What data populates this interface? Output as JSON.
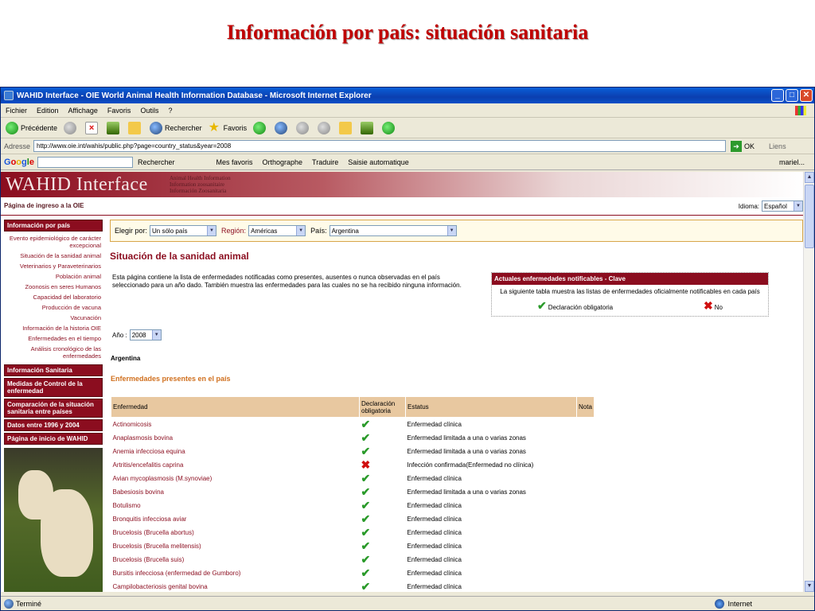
{
  "slide_title": "Información por país: situación sanitaria",
  "window": {
    "title": "WAHID Interface - OIE World Animal Health Information Database - Microsoft Internet Explorer",
    "buttons": {
      "minimize": "_",
      "maximize": "□",
      "close": "✕"
    }
  },
  "menu": [
    "Fichier",
    "Edition",
    "Affichage",
    "Favoris",
    "Outils",
    "?"
  ],
  "toolbar": {
    "back": "Précédente",
    "search": "Rechercher",
    "favorites": "Favoris"
  },
  "address": {
    "label": "Adresse",
    "url": "http://www.oie.int/wahis/public.php?page=country_status&year=2008",
    "go": "OK",
    "links": "Liens"
  },
  "googlebar": {
    "search": "Rechercher",
    "favorites": "Mes favoris",
    "spell": "Orthographe",
    "translate": "Traduire",
    "autofill": "Saisie automatique",
    "user": "mariel..."
  },
  "page": {
    "brand": "WAHID Interface",
    "brand_sub": [
      "Animal Health Information",
      "Information zoosanitaire",
      "Información Zoosanitaria"
    ],
    "home_link": "Página de ingreso a la OIE",
    "language_label": "Idioma:",
    "language_value": "Español",
    "sidebar": {
      "section1": "Información por país",
      "items": [
        "Evento epidemiológico de carácter excepcional",
        "Situación de la sanidad animal",
        "Veterinarios y Paraveterinarios",
        "Población animal",
        "Zoonosis en seres Humanos",
        "Capacidad del laboratorio",
        "Producción de vacuna",
        "Vacunación",
        "Información de la historia OIE",
        "Enfermedades en el tiempo",
        "Análisis cronológico de las enfermedades"
      ],
      "sections": [
        "Información Sanitaria",
        "Medidas de Control de la enfermedad",
        "Comparación de la situación sanitaria entre países",
        "Datos entre 1996 y 2004",
        "Página de inicio de WAHID"
      ]
    },
    "filter": {
      "choose_label": "Elegir por:",
      "choose_value": "Un sólo país",
      "region_label": "Región:",
      "region_value": "Américas",
      "country_label": "País:",
      "country_value": "Argentina"
    },
    "heading": "Situación de la sanidad animal",
    "intro": "Esta página contiene la lista de enfermedades notificadas como presentes, ausentes o nunca observadas en el país seleccionado para un año dado. También muestra las enfermedades para las cuales no se ha recibido ninguna información.",
    "key": {
      "title": "Actuales enfermedades notificables - Clave",
      "text": "La siguiente tabla muestra las listas de enfermedades oficialmente notificables en cada país",
      "yes": "Declaración obligatoria",
      "no": "No"
    },
    "year_label": "Año :",
    "year_value": "2008",
    "country_name": "Argentina",
    "section_heading": "Enfermedades presentes en el país",
    "table": {
      "headers": [
        "Enfermedad",
        "Declaración obligatoria",
        "Estatus",
        "Nota"
      ],
      "rows": [
        {
          "name": "Actinomicosis",
          "mandatory": true,
          "status": "Enfermedad clínica"
        },
        {
          "name": "Anaplasmosis bovina",
          "mandatory": true,
          "status": "Enfermedad limitada a una o varias zonas"
        },
        {
          "name": "Anemia infecciosa equina",
          "mandatory": true,
          "status": "Enfermedad limitada a una o varias zonas"
        },
        {
          "name": "Artritis/encefalitis caprina",
          "mandatory": false,
          "status": "Infección confirmada(Enfermedad no clínica)"
        },
        {
          "name": "Avian mycoplasmosis (M.synoviae)",
          "mandatory": true,
          "status": "Enfermedad clínica"
        },
        {
          "name": "Babesiosis bovina",
          "mandatory": true,
          "status": "Enfermedad limitada a una o varias zonas"
        },
        {
          "name": "Botulismo",
          "mandatory": true,
          "status": "Enfermedad clínica"
        },
        {
          "name": "Bronquitis infecciosa aviar",
          "mandatory": true,
          "status": "Enfermedad clínica"
        },
        {
          "name": "Brucelosis (Brucella abortus)",
          "mandatory": true,
          "status": "Enfermedad clínica"
        },
        {
          "name": "Brucelosis (Brucella melitensis)",
          "mandatory": true,
          "status": "Enfermedad clínica"
        },
        {
          "name": "Brucelosis (Brucella suis)",
          "mandatory": true,
          "status": "Enfermedad clínica"
        },
        {
          "name": "Bursitis infecciosa (enfermedad de Gumboro)",
          "mandatory": true,
          "status": "Enfermedad clínica"
        },
        {
          "name": "Campilobacteriosis genital bovina",
          "mandatory": true,
          "status": "Enfermedad clínica"
        }
      ]
    }
  },
  "status": {
    "left": "Terminé",
    "right": "Internet"
  }
}
